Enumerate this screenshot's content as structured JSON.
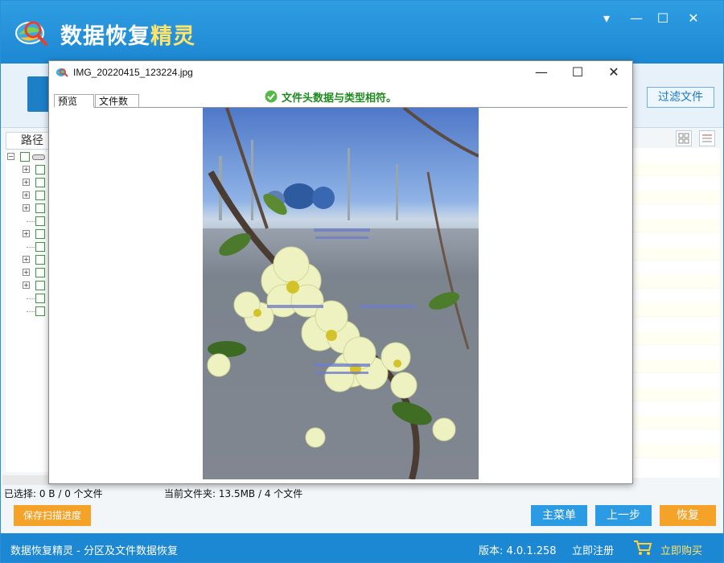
{
  "app": {
    "brand_main": "数据恢复",
    "brand_accent": "精灵",
    "controls": {
      "menu": "▾",
      "minimize": "—",
      "maximize": "☐",
      "close": "✕"
    },
    "filter_button": "过滤文件",
    "path_header": "路径"
  },
  "status": {
    "selected": "已选择: 0 B / 0 个文件",
    "current_folder": "当前文件夹: 13.5MB / 4 个文件"
  },
  "buttons": {
    "save_progress": "保存扫描进度",
    "main_menu": "主菜单",
    "prev_step": "上一步",
    "recover": "恢复"
  },
  "footer": {
    "product": "数据恢复精灵 - 分区及文件数据恢复",
    "version": "版本: 4.0.1.258",
    "register": "立即注册",
    "buy": "立即购买"
  },
  "dialog": {
    "filename": "IMG_20220415_123224.jpg",
    "check_message": "文件头数据与类型相符。",
    "tabs": [
      "预览",
      "文件数据"
    ],
    "controls": {
      "minimize": "—",
      "maximize": "☐",
      "close": "✕"
    }
  },
  "colors": {
    "titlebar": "#1c87d2",
    "accent_orange": "#f5a229",
    "accent_blue": "#2b9be4",
    "check_green": "#1d8a1d"
  }
}
